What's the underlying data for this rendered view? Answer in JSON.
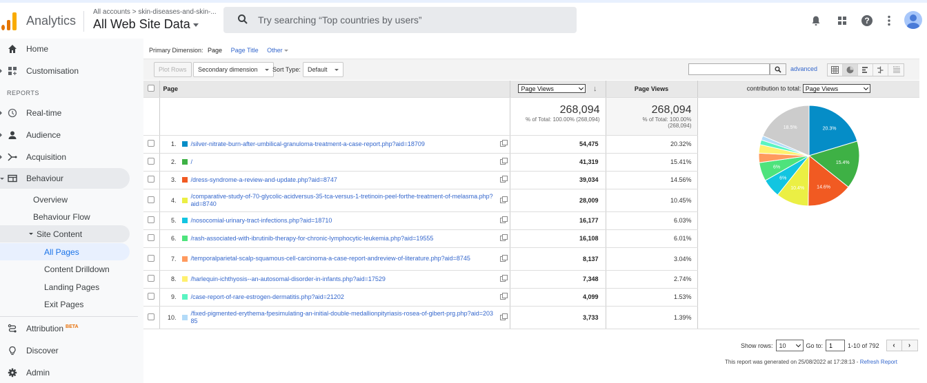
{
  "header": {
    "app_name": "Analytics",
    "breadcrumb": "All accounts > skin-diseases-and-skin-...",
    "property": "All Web Site Data",
    "search_placeholder": "Try searching “Top countries by users”",
    "icons": [
      "bell-icon",
      "apps-grid-icon",
      "help-icon",
      "more-vert-icon",
      "account-avatar-icon"
    ]
  },
  "sidebar": {
    "top_items": [
      {
        "label": "Home",
        "icon": "home-icon"
      },
      {
        "label": "Customisation",
        "icon": "dashboard-icon"
      }
    ],
    "reports_label": "REPORTS",
    "report_items": [
      {
        "label": "Real-time",
        "icon": "clock-icon"
      },
      {
        "label": "Audience",
        "icon": "person-icon"
      },
      {
        "label": "Acquisition",
        "icon": "acquisition-icon"
      },
      {
        "label": "Behaviour",
        "icon": "behaviour-icon"
      }
    ],
    "behaviour_sub": [
      "Overview",
      "Behaviour Flow"
    ],
    "site_content_label": "Site Content",
    "site_content_sub": [
      "All Pages",
      "Content Drilldown",
      "Landing Pages",
      "Exit Pages"
    ],
    "selected": "All Pages",
    "bottom_items": [
      {
        "label": "Attribution",
        "badge": "BETA",
        "icon": "attribution-icon"
      },
      {
        "label": "Discover",
        "icon": "lightbulb-icon"
      },
      {
        "label": "Admin",
        "icon": "gear-icon"
      }
    ]
  },
  "report": {
    "primary_dimension_label": "Primary Dimension:",
    "primary_dimension_current": "Page",
    "primary_dimension_options": [
      "Page Title",
      "Other"
    ],
    "plot_rows": "Plot Rows",
    "secondary_dimension": "Secondary dimension",
    "sort_type_label": "Sort Type:",
    "sort_type_value": "Default",
    "search_value": "",
    "advanced": "advanced",
    "view_modes": [
      "data-table-icon",
      "pie-chart-icon",
      "performance-icon",
      "comparison-icon",
      "pivot-icon"
    ],
    "active_view": "pie-chart-icon",
    "columns": {
      "page": "Page",
      "metric_select": "Page Views",
      "metric": "Page Views",
      "contribution_label": "contribution to total:",
      "contribution_select": "Page Views"
    },
    "totals": {
      "value": "268,094",
      "percent_line": "% of Total: 100.00% (268,094)",
      "percent_line_a": "% of Total: 100.00%",
      "percent_line_b": "(268,094)"
    },
    "rows": [
      {
        "n": "1.",
        "page": "/silver-nitrate-burn-after-umbilical-granuloma-treatment-a-case-report.php?aid=18709",
        "views": "54,475",
        "pct": "20.32%",
        "color": "#058dc7"
      },
      {
        "n": "2.",
        "page": "/",
        "views": "41,319",
        "pct": "15.41%",
        "color": "#3eb145"
      },
      {
        "n": "3.",
        "page": "/dress-syndrome-a-review-and-update.php?aid=8747",
        "views": "39,034",
        "pct": "14.56%",
        "color": "#f15a22"
      },
      {
        "n": "4.",
        "page": "/comparative-study-of-70-glycolic-acidversus-35-tca-versus-1-tretinoin-peel-forthe-treatment-of-melasma.php?aid=8740",
        "views": "28,009",
        "pct": "10.45%",
        "color": "#ebef44"
      },
      {
        "n": "5.",
        "page": "/nosocomial-urinary-tract-infections.php?aid=18710",
        "views": "16,177",
        "pct": "6.03%",
        "color": "#12c5e1"
      },
      {
        "n": "6.",
        "page": "/rash-associated-with-ibrutinib-therapy-for-chronic-lymphocytic-leukemia.php?aid=19555",
        "views": "16,108",
        "pct": "6.01%",
        "color": "#4ee37c"
      },
      {
        "n": "7.",
        "page": "/temporalparietal-scalp-squamous-cell-carcinoma-a-case-report-andreview-of-literature.php?aid=8745",
        "views": "8,137",
        "pct": "3.04%",
        "color": "#ff9a5e"
      },
      {
        "n": "8.",
        "page": "/harlequin-ichthyosis--an-autosomal-disorder-in-infants.php?aid=17529",
        "views": "7,348",
        "pct": "2.74%",
        "color": "#fff06e"
      },
      {
        "n": "9.",
        "page": "/case-report-of-rare-estrogen-dermatitis.php?aid=21202",
        "views": "4,099",
        "pct": "1.53%",
        "color": "#5af4c2"
      },
      {
        "n": "10.",
        "page": "/fixed-pigmented-erythema-fpesimulating-an-initial-double-medallionpityriasis-rosea-of-gibert-prg.php?aid=20385",
        "views": "3,733",
        "pct": "1.39%",
        "color": "#b3dbf8"
      }
    ],
    "other_color": "#cccccc",
    "footer": {
      "show_rows_label": "Show rows:",
      "show_rows_value": "10",
      "goto_label": "Go to:",
      "goto_value": "1",
      "range": "1-10 of 792",
      "generated": "This report was generated on 25/08/2022 at 17:28:13 - ",
      "refresh": "Refresh Report"
    }
  },
  "chart_data": {
    "type": "pie",
    "title": "contribution to total: Page Views",
    "categories": [
      "Row 1",
      "Row 2",
      "Row 3",
      "Row 4",
      "Row 5",
      "Row 6",
      "Row 7",
      "Row 8",
      "Row 9",
      "Row 10",
      "(other)"
    ],
    "values": [
      20.32,
      15.41,
      14.56,
      10.45,
      6.03,
      6.01,
      3.04,
      2.74,
      1.53,
      1.39,
      18.52
    ],
    "labels": [
      "20.3%",
      "15.4%",
      "14.6%",
      "10.4%",
      "6%",
      "6%",
      "",
      "",
      "",
      "",
      "18.5%"
    ],
    "colors": [
      "#058dc7",
      "#3eb145",
      "#f15a22",
      "#ebef44",
      "#12c5e1",
      "#4ee37c",
      "#ff9a5e",
      "#fff06e",
      "#5af4c2",
      "#b3dbf8",
      "#cccccc"
    ]
  }
}
